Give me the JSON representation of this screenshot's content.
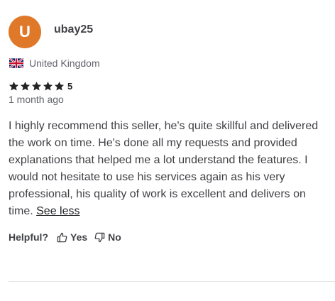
{
  "review": {
    "avatar_letter": "U",
    "avatar_color": "#e0782a",
    "username": "ubay25",
    "country": "United Kingdom",
    "flag_icon": "uk-flag-icon",
    "rating": "5",
    "star_color": "#222325",
    "time_ago": "1 month ago",
    "text": "I highly recommend this seller, he's quite skillful and delivered the work on time. He's done all my requests and provided explanations that helped me a lot understand the features. I would not hesitate to use his services again as his very professional, his quality of work is excellent and delivers on time.",
    "see_less": "See less",
    "helpful_label": "Helpful?",
    "yes_label": "Yes",
    "no_label": "No"
  }
}
